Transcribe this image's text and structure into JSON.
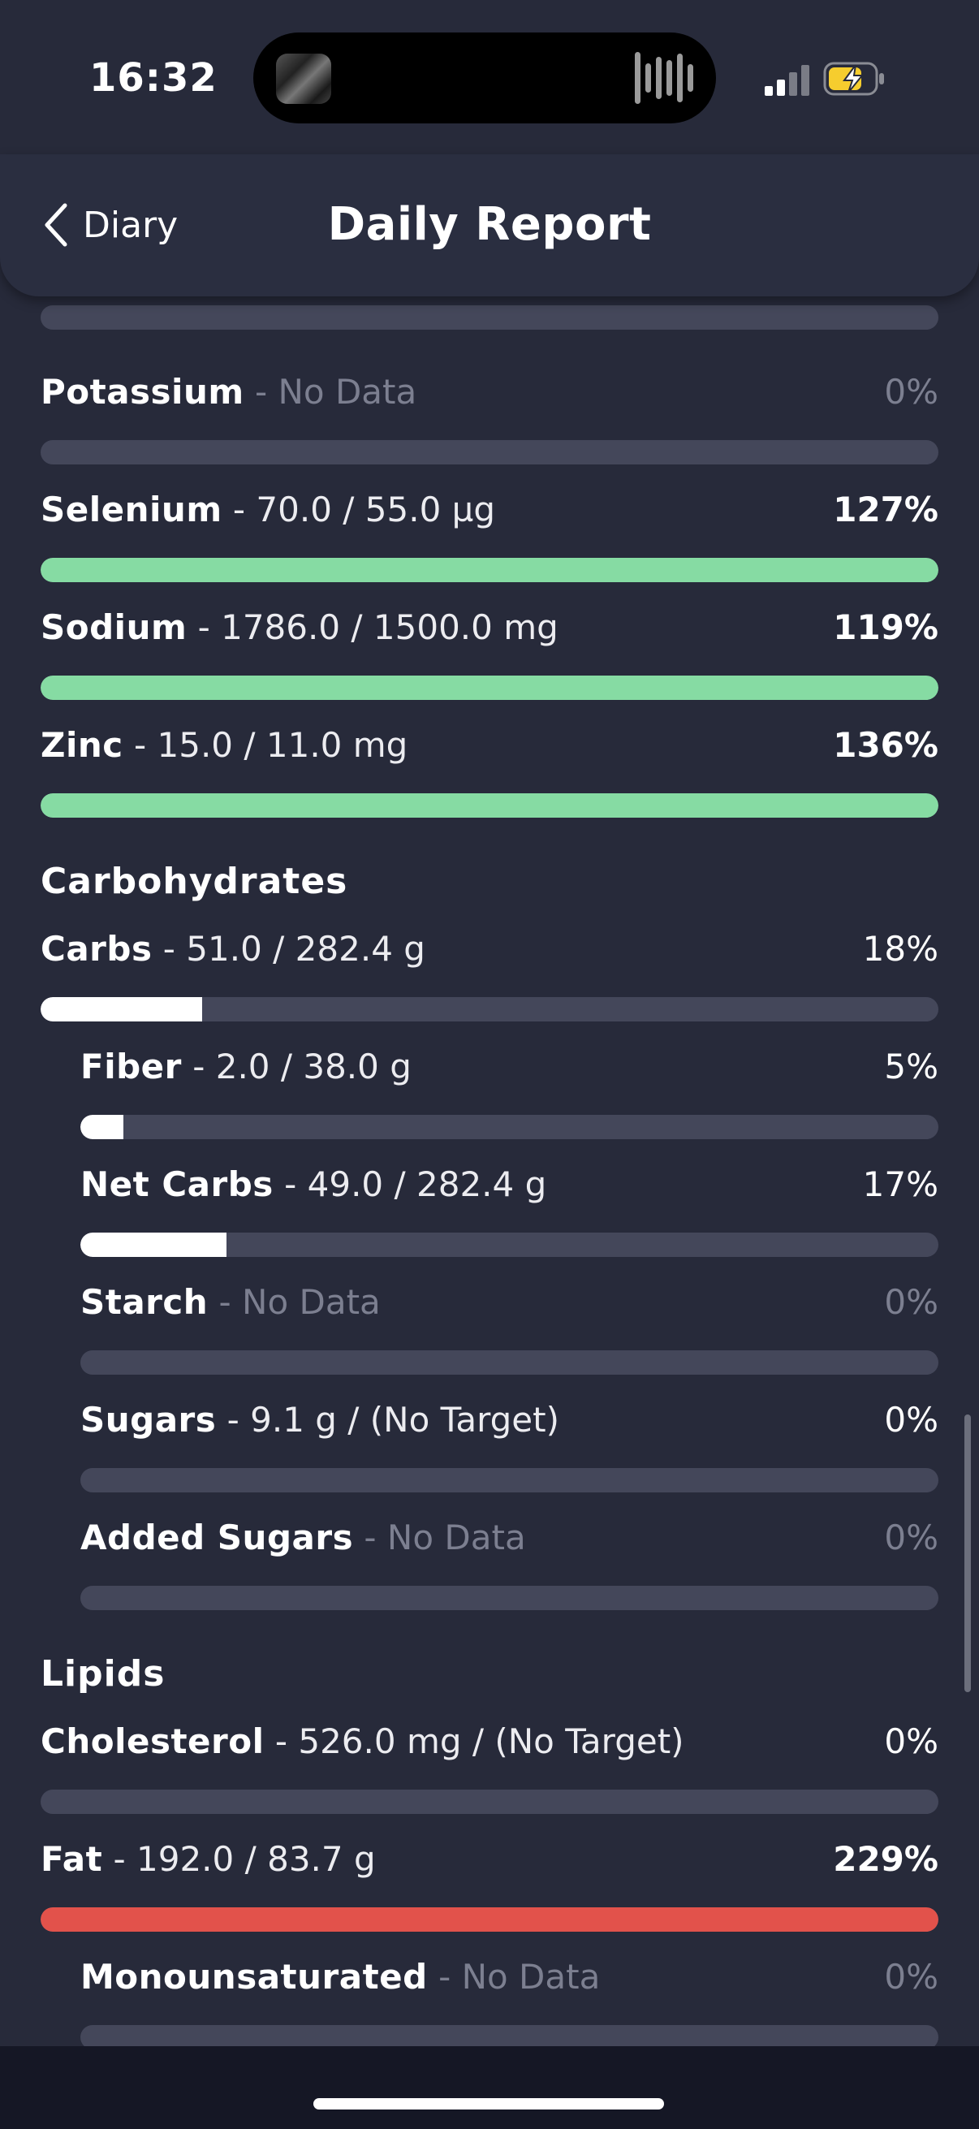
{
  "status_bar": {
    "time": "16:32"
  },
  "nav": {
    "back_label": "Diary",
    "title": "Daily Report"
  },
  "colors": {
    "good": "#86dba3",
    "neutral": "#ffffff",
    "over": "#e2524b",
    "track": "#44475a"
  },
  "minerals": [
    {
      "name": "Potassium",
      "detail": " - No Data",
      "percent": "0%",
      "progress": 0,
      "status": "nodata"
    },
    {
      "name": "Selenium",
      "detail": " - 70.0 / 55.0 µg",
      "percent": "127%",
      "progress": 1.0,
      "status": "good"
    },
    {
      "name": "Sodium",
      "detail": " - 1786.0 / 1500.0 mg",
      "percent": "119%",
      "progress": 1.0,
      "status": "good"
    },
    {
      "name": "Zinc",
      "detail": " - 15.0 / 11.0 mg",
      "percent": "136%",
      "progress": 1.0,
      "status": "good"
    }
  ],
  "carbohydrates": {
    "section_title": "Carbohydrates",
    "items": [
      {
        "name": "Carbs",
        "detail": " - 51.0 / 282.4 g",
        "percent": "18%",
        "progress": 0.18,
        "status": "neutral"
      },
      {
        "name": "Fiber",
        "detail": " - 2.0 / 38.0 g",
        "percent": "5%",
        "progress": 0.05,
        "status": "neutral"
      },
      {
        "name": "Net Carbs",
        "detail": " - 49.0 / 282.4 g",
        "percent": "17%",
        "progress": 0.17,
        "status": "neutral"
      },
      {
        "name": "Starch",
        "detail": " - No Data",
        "percent": "0%",
        "progress": 0,
        "status": "nodata"
      },
      {
        "name": "Sugars",
        "detail": " - 9.1 g / (No Target)",
        "percent": "0%",
        "progress": 0,
        "status": "neutral"
      },
      {
        "name": "Added Sugars",
        "detail": " - No Data",
        "percent": "0%",
        "progress": 0,
        "status": "nodata"
      }
    ]
  },
  "lipids": {
    "section_title": "Lipids",
    "items": [
      {
        "name": "Cholesterol",
        "detail": " - 526.0 mg / (No Target)",
        "percent": "0%",
        "progress": 0,
        "status": "neutral"
      },
      {
        "name": "Fat",
        "detail": " - 192.0 / 83.7 g",
        "percent": "229%",
        "progress": 1.0,
        "status": "over"
      },
      {
        "name": "Monounsaturated",
        "detail": " - No Data",
        "percent": "0%",
        "progress": 0,
        "status": "nodata"
      }
    ]
  }
}
